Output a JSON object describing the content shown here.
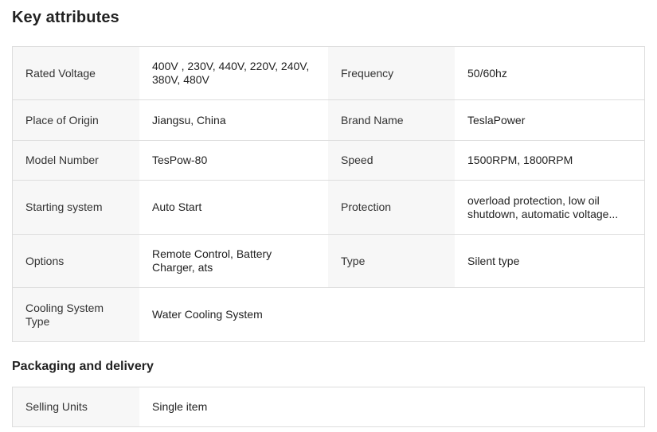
{
  "key_attributes": {
    "title": "Key attributes",
    "rows": [
      {
        "k1": "Rated Voltage",
        "v1": "400V , 230V, 440V, 220V, 240V, 380V, 480V",
        "k2": "Frequency",
        "v2": "50/60hz"
      },
      {
        "k1": "Place of Origin",
        "v1": "Jiangsu, China",
        "k2": "Brand Name",
        "v2": "TeslaPower"
      },
      {
        "k1": "Model Number",
        "v1": "TesPow-80",
        "k2": "Speed",
        "v2": "1500RPM, 1800RPM"
      },
      {
        "k1": "Starting system",
        "v1": "Auto Start",
        "k2": "Protection",
        "v2": "overload protection, low oil shutdown, automatic voltage..."
      },
      {
        "k1": "Options",
        "v1": "Remote Control, Battery Charger, ats",
        "k2": "Type",
        "v2": "Silent type"
      },
      {
        "k1": "Cooling System Type",
        "v1": "Water Cooling System"
      }
    ]
  },
  "packaging": {
    "title": "Packaging and delivery",
    "rows": [
      {
        "k1": "Selling Units",
        "v1": "Single item"
      }
    ]
  }
}
